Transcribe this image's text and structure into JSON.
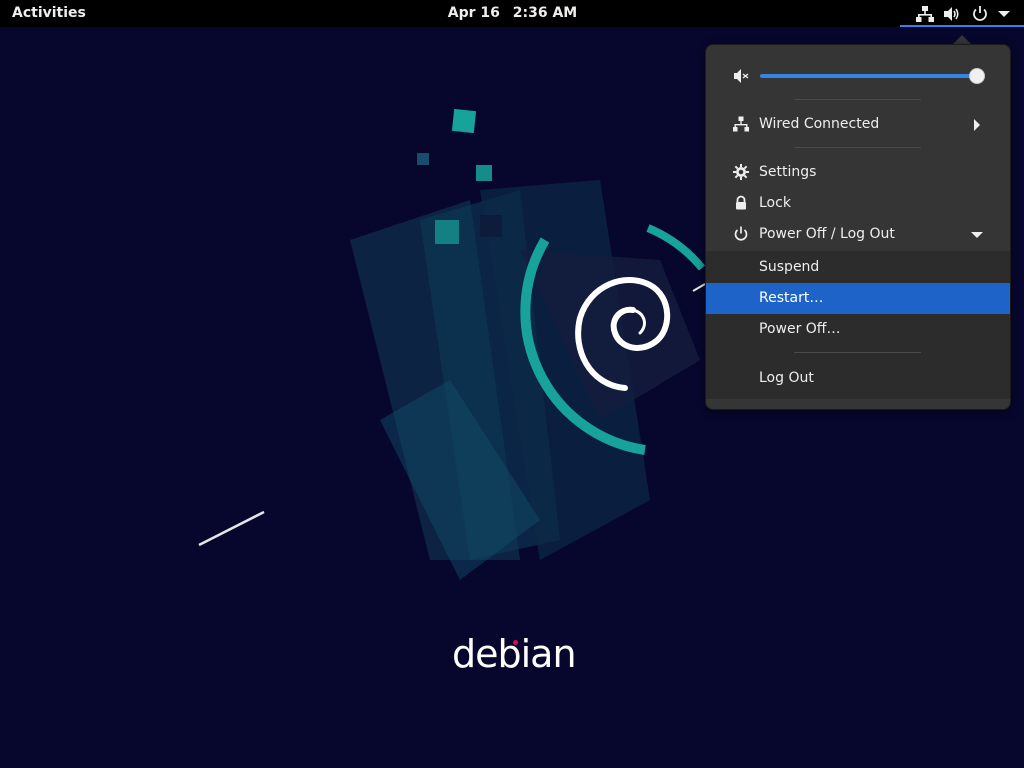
{
  "topbar": {
    "activities_label": "Activities",
    "clock_date": "Apr 16",
    "clock_time": "2:36 AM",
    "status_icons": [
      "network-wired-icon",
      "volume-icon",
      "power-icon",
      "chevron-down-icon"
    ]
  },
  "system_menu": {
    "volume": {
      "level": 1.0,
      "icon": "volume-icon"
    },
    "network": {
      "label": "Wired Connected",
      "icon": "network-wired-icon"
    },
    "settings_label": "Settings",
    "lock_label": "Lock",
    "power_label": "Power Off / Log Out",
    "submenu": {
      "suspend_label": "Suspend",
      "restart_label": "Restart…",
      "poweroff_label": "Power Off…",
      "logout_label": "Log Out",
      "active_item": "Restart…"
    }
  },
  "desktop": {
    "wordmark": "debian"
  },
  "colors": {
    "accent": "#3584e4",
    "selected": "#1e64c8",
    "wallpaper": "#07072e",
    "teal": "#17a29a",
    "debian_red": "#d70a53"
  }
}
